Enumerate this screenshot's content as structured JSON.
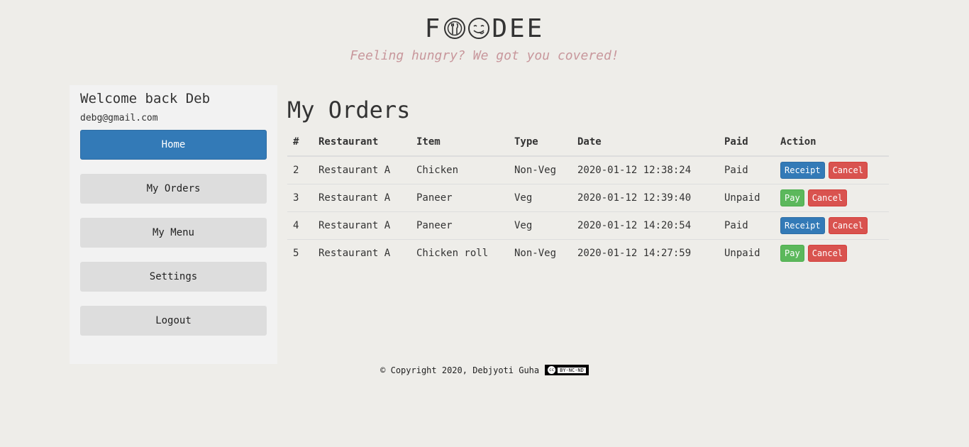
{
  "header": {
    "brand_prefix": "F",
    "brand_suffix": "DEE",
    "tagline": "Feeling hungry? We got you covered!"
  },
  "sidebar": {
    "welcome": "Welcome back Deb",
    "email": "debg@gmail.com",
    "items": [
      {
        "label": "Home"
      },
      {
        "label": "My Orders"
      },
      {
        "label": "My Menu"
      },
      {
        "label": "Settings"
      },
      {
        "label": "Logout"
      }
    ]
  },
  "main": {
    "title": "My Orders",
    "columns": [
      "#",
      "Restaurant",
      "Item",
      "Type",
      "Date",
      "Paid",
      "Action"
    ],
    "rows": [
      {
        "id": "2",
        "restaurant": "Restaurant A",
        "item": "Chicken",
        "type": "Non-Veg",
        "date": "2020-01-12 12:38:24",
        "paid": "Paid",
        "primary_action": "Receipt",
        "secondary_action": "Cancel"
      },
      {
        "id": "3",
        "restaurant": "Restaurant A",
        "item": "Paneer",
        "type": "Veg",
        "date": "2020-01-12 12:39:40",
        "paid": "Unpaid",
        "primary_action": "Pay",
        "secondary_action": "Cancel"
      },
      {
        "id": "4",
        "restaurant": "Restaurant A",
        "item": "Paneer",
        "type": "Veg",
        "date": "2020-01-12 14:20:54",
        "paid": "Paid",
        "primary_action": "Receipt",
        "secondary_action": "Cancel"
      },
      {
        "id": "5",
        "restaurant": "Restaurant A",
        "item": "Chicken roll",
        "type": "Non-Veg",
        "date": "2020-01-12 14:27:59",
        "paid": "Unpaid",
        "primary_action": "Pay",
        "secondary_action": "Cancel"
      }
    ]
  },
  "footer": {
    "copyright": "© Copyright 2020, Debjyoti Guha",
    "license_badge_cc": "cc",
    "license_badge_text": "BY-NC-ND"
  },
  "colors": {
    "background": "#eeede9",
    "accent": "#337ab7",
    "success": "#5cb85c",
    "danger": "#d9534f",
    "tagline": "#c8979c"
  },
  "icons": {
    "logo_o1": "plate-fork-knife-icon",
    "logo_o2": "yummy-face-icon"
  }
}
